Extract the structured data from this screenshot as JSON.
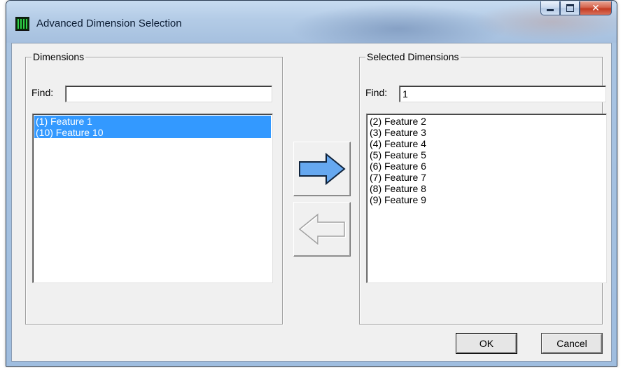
{
  "window": {
    "title": "Advanced Dimension Selection",
    "icon": "app-grid-icon",
    "controls": {
      "minimize": "minimize-icon",
      "maximize": "maximize-icon",
      "close": "✕"
    }
  },
  "dimensions": {
    "group_label": "Dimensions",
    "find_label": "Find:",
    "find_value": "",
    "items": [
      {
        "label": "(1) Feature  1",
        "selected": true
      },
      {
        "label": "(10) Feature  10",
        "selected": true
      }
    ]
  },
  "selected_dimensions": {
    "group_label": "Selected Dimensions",
    "find_label": "Find:",
    "find_value": "1",
    "items": [
      {
        "label": "(2) Feature  2",
        "selected": false
      },
      {
        "label": "(3) Feature  3",
        "selected": false
      },
      {
        "label": "(4) Feature  4",
        "selected": false
      },
      {
        "label": "(5) Feature  5",
        "selected": false
      },
      {
        "label": "(6) Feature  6",
        "selected": false
      },
      {
        "label": "(7) Feature  7",
        "selected": false
      },
      {
        "label": "(8) Feature  8",
        "selected": false
      },
      {
        "label": "(9) Feature  9",
        "selected": false
      }
    ]
  },
  "transfer": {
    "add_icon": "arrow-right-icon",
    "remove_icon": "arrow-left-icon",
    "add_color": "#66a8f0",
    "remove_enabled": false
  },
  "buttons": {
    "ok": "OK",
    "cancel": "Cancel"
  },
  "colors": {
    "selection": "#3399ff",
    "dialog_bg": "#f0f0f0"
  }
}
